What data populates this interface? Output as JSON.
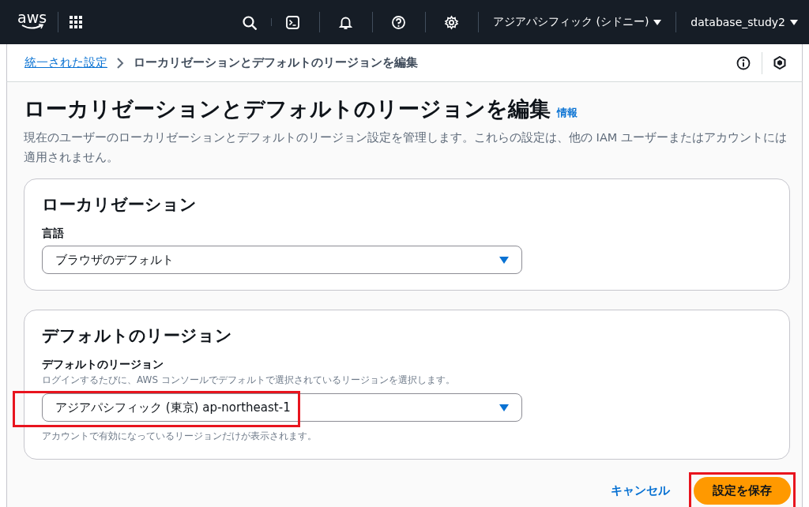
{
  "top_nav": {
    "logo": "aws",
    "region": "アジアパシフィック (シドニー)",
    "account": "database_study2"
  },
  "breadcrumbs": [
    {
      "label": "統一された設定",
      "kind": "link"
    },
    {
      "label": "ローカリゼーションとデフォルトのリージョンを編集",
      "kind": "current"
    }
  ],
  "header": {
    "title": "ローカリゼーションとデフォルトのリージョンを編集",
    "info_link": "情報",
    "description": "現在のユーザーのローカリゼーションとデフォルトのリージョン設定を管理します。これらの設定は、他の IAM ユーザーまたはアカウントには適用されません。"
  },
  "sections": [
    {
      "title": "ローカリゼーション",
      "fields": [
        {
          "label": "言語",
          "value": "ブラウザのデフォルト",
          "highlighted": false
        }
      ]
    },
    {
      "title": "デフォルトのリージョン",
      "fields": [
        {
          "label": "デフォルトのリージョン",
          "description": "ログインするたびに、AWS コンソールでデフォルトで選択されているリージョンを選択します。",
          "value": "アジアパシフィック (東京) ap-northeast-1",
          "constraint": "アカウントで有効になっているリージョンだけが表示されます。",
          "highlighted": true
        }
      ]
    }
  ],
  "actions": [
    {
      "label": "キャンセル",
      "kind": "link",
      "highlighted": false
    },
    {
      "label": "設定を保存",
      "kind": "primary",
      "highlighted": true
    }
  ]
}
